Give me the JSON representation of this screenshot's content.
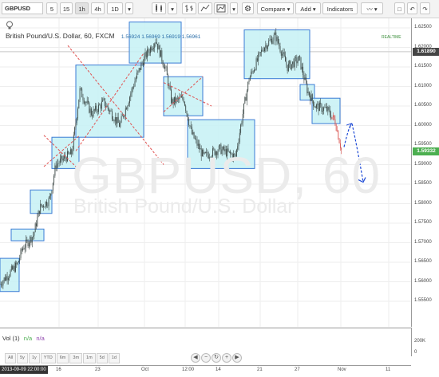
{
  "toolbar": {
    "symbol": "GBPUSD",
    "intervals": [
      "5",
      "15",
      "1h",
      "4h",
      "1D"
    ],
    "active_interval": "1h",
    "compare_label": "Compare",
    "add_label": "Add",
    "indicators_label": "Indicators"
  },
  "legend": {
    "title": "British Pound/U.S. Dollar, 60, FXCM",
    "ohlc": "1.56924  1.56969  1.56919  1.56961"
  },
  "realtime_label": "REALTIME",
  "watermark": {
    "symbol": "GBPUSD, 60",
    "name": "British Pound/U.S. Dollar"
  },
  "price_axis": {
    "ticks": [
      "1.62500",
      "1.62000",
      "1.61500",
      "1.61000",
      "1.60500",
      "1.60000",
      "1.59500",
      "1.59000",
      "1.58500",
      "1.58000",
      "1.57500",
      "1.57000",
      "1.56500",
      "1.56000",
      "1.55500"
    ],
    "marker_upper": "1.61890",
    "marker_current": "1.59332"
  },
  "volume": {
    "label": "Vol (1)",
    "na1": "n/a",
    "na2": "n/a",
    "tick": "200K",
    "tick0": "0"
  },
  "range_buttons": [
    "All",
    "5y",
    "1y",
    "YTD",
    "6m",
    "3m",
    "1m",
    "5d",
    "1d"
  ],
  "nav_icons": [
    "◀",
    "−",
    "↻",
    "+",
    "▶"
  ],
  "time_axis": {
    "current": "2013-09-09 22:00:00",
    "labels": [
      "16",
      "23",
      "Oct",
      "12:00",
      "14",
      "21",
      "27",
      "Nov",
      "11"
    ]
  },
  "colors": {
    "box_fill": "#c6f1f5",
    "box_stroke": "#3a7bd5",
    "cross": "#e0504f",
    "dash_arrow": "#1f4bd6",
    "candle": "#3e4a48",
    "current_price": "#4caf50",
    "marker_upper": "#444444"
  }
}
